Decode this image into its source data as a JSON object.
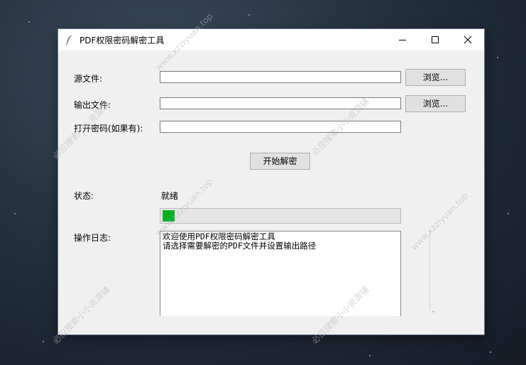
{
  "window": {
    "title": "PDF权限密码解密工具"
  },
  "form": {
    "source_label": "源文件:",
    "source_value": "",
    "output_label": "输出文件:",
    "output_value": "",
    "password_label": "打开密码(如果有):",
    "password_value": "",
    "browse_source_label": "浏览...",
    "browse_output_label": "浏览...",
    "start_button_label": "开始解密"
  },
  "status": {
    "label": "状态:",
    "value": "就绪",
    "progress_fraction": 0.05
  },
  "log": {
    "label": "操作日志:",
    "lines": [
      "欢迎使用PDF权限密码解密工具",
      "请选择需要解密的PDF文件并设置输出路径"
    ]
  },
  "watermarks": {
    "text_1": "www.xzziyuan.top",
    "text_2": "必应搜索小小资源铺"
  },
  "colors": {
    "progress_fill": "#06b025",
    "window_bg": "#f0f0f0"
  }
}
